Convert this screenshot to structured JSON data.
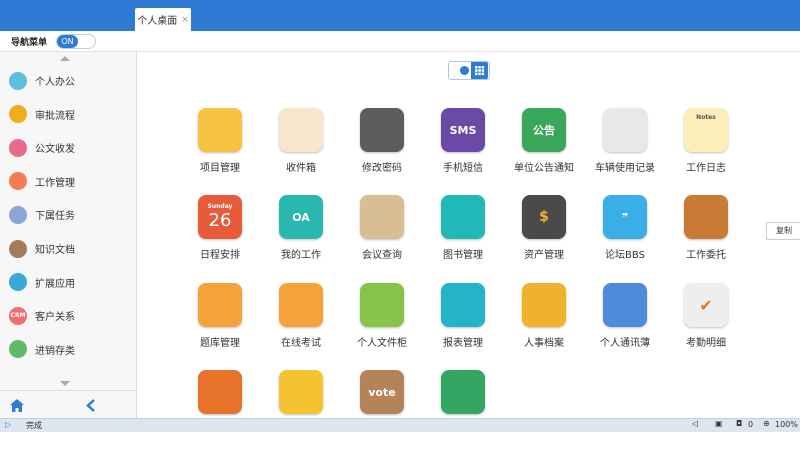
{
  "tabs": [
    {
      "label": "个人桌面",
      "close": "×"
    }
  ],
  "nav": {
    "label": "导航菜单",
    "toggle": "ON"
  },
  "sidebar": {
    "items": [
      {
        "label": "个人办公",
        "color": "#5bc0de",
        "icon": "person-icon"
      },
      {
        "label": "审批流程",
        "color": "#f0ad1c",
        "icon": "approval-icon"
      },
      {
        "label": "公文收发",
        "color": "#e96b8b",
        "icon": "document-icon"
      },
      {
        "label": "工作管理",
        "color": "#f47b55",
        "icon": "work-icon"
      },
      {
        "label": "下属任务",
        "color": "#8ba5d6",
        "icon": "team-icon"
      },
      {
        "label": "知识文档",
        "color": "#a57b5a",
        "icon": "book-icon"
      },
      {
        "label": "扩展应用",
        "color": "#3aa8d8",
        "icon": "puzzle-icon"
      },
      {
        "label": "客户关系",
        "color": "#f26d6d",
        "icon": "crm-icon",
        "badge": "CRM"
      },
      {
        "label": "进销存类",
        "color": "#63b86a",
        "icon": "inventory-icon"
      }
    ]
  },
  "desktop": {
    "apps": [
      {
        "label": "项目管理",
        "icon": "notebook-icon",
        "color": "#f6c341"
      },
      {
        "label": "收件箱",
        "icon": "inbox-icon",
        "color": "#f5e6cc"
      },
      {
        "label": "修改密码",
        "icon": "settings-icon",
        "color": "#5d5d5d"
      },
      {
        "label": "手机短信",
        "icon": "sms-icon",
        "color": "#6b4aa6",
        "badge": "SMS"
      },
      {
        "label": "单位公告通知",
        "icon": "board-icon",
        "color": "#3aa659",
        "badge": "公告"
      },
      {
        "label": "车辆使用记录",
        "icon": "gauge-icon",
        "color": "#e8e8e8"
      },
      {
        "label": "工作日志",
        "icon": "notes-icon",
        "color": "#fbeeb8",
        "badge": "Notes"
      },
      {
        "label": "日程安排",
        "icon": "calendar-icon",
        "color": "#e85b3a",
        "badge": "Sunday",
        "number": "26"
      },
      {
        "label": "我的工作",
        "icon": "oa-icon",
        "color": "#2ab7b0",
        "badge": "OA"
      },
      {
        "label": "会议查询",
        "icon": "meeting-icon",
        "color": "#d9bd94"
      },
      {
        "label": "图书管理",
        "icon": "book-icon",
        "color": "#21b9b8"
      },
      {
        "label": "资产管理",
        "icon": "wallet-icon",
        "color": "#4a4a4a",
        "badge": "$"
      },
      {
        "label": "论坛BBS",
        "icon": "quote-icon",
        "color": "#3aaee6",
        "badge": "❞"
      },
      {
        "label": "工作委托",
        "icon": "delegate-icon",
        "color": "#c77b35"
      },
      {
        "label": "题库管理",
        "icon": "clock-icon",
        "color": "#f4a33a"
      },
      {
        "label": "在线考试",
        "icon": "exam-icon",
        "color": "#f4a33a"
      },
      {
        "label": "个人文件柜",
        "icon": "cabinet-icon",
        "color": "#86c44a"
      },
      {
        "label": "报表管理",
        "icon": "chart-icon",
        "color": "#23b5c7"
      },
      {
        "label": "人事档案",
        "icon": "personnel-icon",
        "color": "#f0b22e"
      },
      {
        "label": "个人通讯薄",
        "icon": "contacts-icon",
        "color": "#4f8bd9"
      },
      {
        "label": "考勤明细",
        "icon": "attendance-icon",
        "color": "#eeeeee",
        "badge": "✔"
      },
      {
        "label": "",
        "icon": "origami-icon",
        "color": "#e8742b"
      },
      {
        "label": "",
        "icon": "folder-icon",
        "color": "#f5c232"
      },
      {
        "label": "",
        "icon": "vote-icon",
        "color": "#b5835a",
        "badge": "vote"
      },
      {
        "label": "",
        "icon": "clipboard-icon",
        "color": "#33a663"
      }
    ]
  },
  "copy_button": "复制",
  "status": {
    "text": "完成",
    "zoom": "100%",
    "count": "0"
  }
}
